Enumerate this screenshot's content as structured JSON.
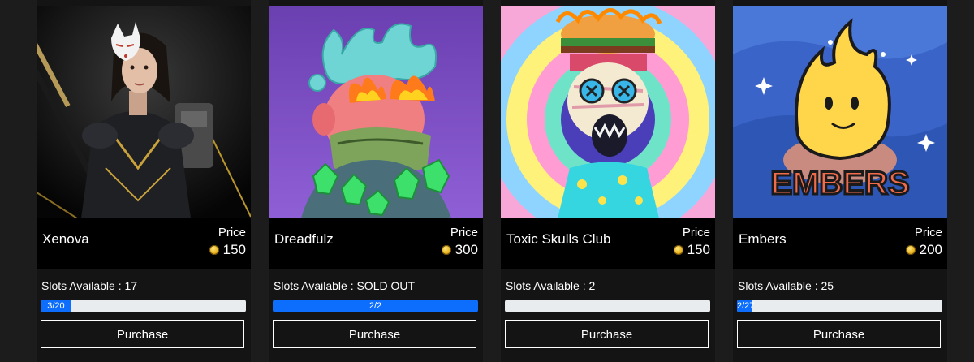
{
  "cards": [
    {
      "name": "Xenova",
      "price_label": "Price",
      "price": "150",
      "slots_text": "Slots Available : 17",
      "progress_label": "3/20",
      "progress_fraction": 0.15,
      "button_label": "Purchase",
      "art_icon": "warrior-girl-fox-mask-art"
    },
    {
      "name": "Dreadfulz",
      "price_label": "Price",
      "price": "300",
      "slots_text": "Slots Available : SOLD OUT",
      "progress_label": "2/2",
      "progress_fraction": 1.0,
      "button_label": "Purchase",
      "art_icon": "coral-head-monster-art"
    },
    {
      "name": "Toxic Skulls Club",
      "price_label": "Price",
      "price": "150",
      "slots_text": "Slots Available : 2",
      "progress_label": "",
      "progress_fraction": 0.0,
      "button_label": "Purchase",
      "art_icon": "skull-burger-hat-art"
    },
    {
      "name": "Embers",
      "price_label": "Price",
      "price": "200",
      "slots_text": "Slots Available : 25",
      "progress_label": "2/27",
      "progress_fraction": 0.074,
      "button_label": "Purchase",
      "art_icon": "embers-flame-mascot-art"
    }
  ],
  "embers_logo_text": "EMBERS",
  "colors": {
    "page_bg": "#1c1c1c",
    "card_bg": "#141414",
    "info_bg": "#000000",
    "progress_fill": "#0d6efd",
    "progress_track": "#e9ecef",
    "coin": "#e7b21c"
  }
}
